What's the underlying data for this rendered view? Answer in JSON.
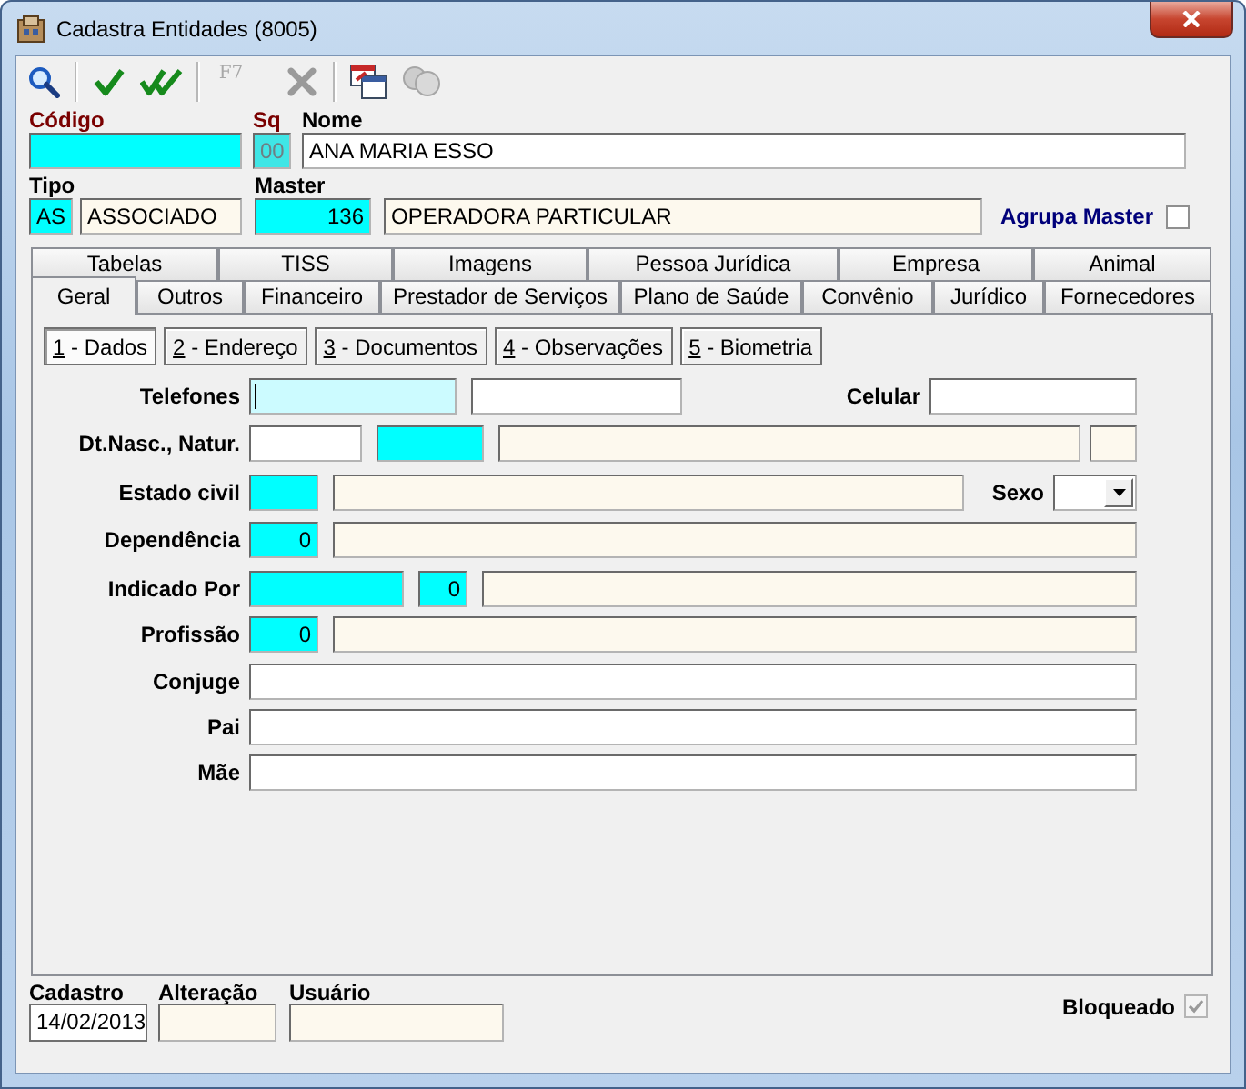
{
  "window": {
    "title": "Cadastra Entidades (8005)"
  },
  "toolbar": [
    [
      {
        "kind": "search",
        "disabled": false
      }
    ],
    [
      {
        "kind": "confirm",
        "disabled": false
      },
      {
        "kind": "confirm-all",
        "disabled": false
      }
    ],
    [
      {
        "kind": "f7",
        "label": "F7",
        "disabled": true
      },
      {
        "kind": "cancel",
        "disabled": true
      }
    ],
    [
      {
        "kind": "windows",
        "disabled": false
      },
      {
        "kind": "coins",
        "disabled": true
      }
    ]
  ],
  "header": [
    [
      {
        "label": "Código",
        "required_label": true,
        "fields": [
          {
            "kind": "required"
          }
        ]
      },
      {
        "label": "Sq",
        "required_label": true,
        "fields": [
          {
            "value": "00",
            "kind": "locked"
          }
        ]
      },
      {
        "label": "Nome",
        "required_label": false,
        "fields": [
          {
            "value": "ANA MARIA ESSO",
            "kind": "normal"
          }
        ]
      }
    ],
    [
      {
        "label": "Tipo",
        "required_label": false,
        "fields": [
          {
            "value": "AS",
            "kind": "required"
          },
          {
            "value": "ASSOCIADO",
            "kind": "readonly"
          }
        ]
      },
      {
        "label": "Master",
        "required_label": false,
        "fields": [
          {
            "value": "136",
            "kind": "required",
            "numeric": true
          },
          {
            "value": "OPERADORA PARTICULAR",
            "kind": "readonly"
          }
        ]
      }
    ]
  ],
  "agrupa_master": {
    "label": "Agrupa Master",
    "checked": false,
    "disabled": false
  },
  "tab_rows": [
    [
      {
        "label": "Tabelas",
        "selected": false
      },
      {
        "label": "TISS",
        "selected": false
      },
      {
        "label": "Imagens",
        "selected": false
      },
      {
        "label": "Pessoa Jurídica",
        "selected": false
      },
      {
        "label": "Empresa",
        "selected": false
      },
      {
        "label": "Animal",
        "selected": false
      }
    ],
    [
      {
        "label": "Geral",
        "selected": true
      },
      {
        "label": "Outros",
        "selected": false
      },
      {
        "label": "Financeiro",
        "selected": false
      },
      {
        "label": "Prestador de Serviços",
        "selected": false
      },
      {
        "label": "Plano de Saúde",
        "selected": false
      },
      {
        "label": "Convênio",
        "selected": false
      },
      {
        "label": "Jurídico",
        "selected": false
      },
      {
        "label": "Fornecedores",
        "selected": false
      }
    ]
  ],
  "subtabs": [
    {
      "label": "1 - Dados",
      "selected": true
    },
    {
      "label": "2 - Endereço",
      "selected": false
    },
    {
      "label": "3 - Documentos",
      "selected": false
    },
    {
      "label": "4 - Observações",
      "selected": false
    },
    {
      "label": "5 - Biometria",
      "selected": false
    }
  ],
  "form_rows": [
    {
      "label": "Telefones",
      "fields": [
        {
          "kind": "focused"
        },
        {
          "kind": "normal"
        }
      ],
      "extra": {
        "label": "Celular",
        "fields": [
          {
            "kind": "normal"
          }
        ]
      }
    },
    {
      "label": "Dt.Nasc., Natur.",
      "fields": [
        {
          "kind": "normal"
        },
        {
          "kind": "required"
        },
        {
          "kind": "readonly"
        },
        {
          "kind": "readonly"
        }
      ]
    },
    {
      "label": "Estado civil",
      "fields": [
        {
          "kind": "required"
        },
        {
          "kind": "readonly"
        }
      ],
      "extra": {
        "label": "Sexo",
        "fields": [
          {
            "kind": "combo"
          }
        ]
      }
    },
    {
      "label": "Dependência",
      "fields": [
        {
          "value": "0",
          "kind": "required",
          "numeric": true
        },
        {
          "kind": "readonly"
        }
      ]
    },
    {
      "label": "Indicado Por",
      "fields": [
        {
          "kind": "required"
        },
        {
          "value": "0",
          "kind": "required",
          "numeric": true
        },
        {
          "kind": "readonly"
        }
      ]
    },
    {
      "label": "Profissão",
      "fields": [
        {
          "value": "0",
          "kind": "required",
          "numeric": true
        },
        {
          "kind": "readonly"
        }
      ]
    },
    {
      "label": "Conjuge",
      "fields": [
        {
          "kind": "normal"
        }
      ]
    },
    {
      "label": "Pai",
      "fields": [
        {
          "kind": "normal"
        }
      ]
    },
    {
      "label": "Mãe",
      "fields": [
        {
          "kind": "normal"
        }
      ]
    }
  ],
  "footer": {
    "fields": [
      {
        "label": "Cadastro",
        "value": "14/02/2013",
        "kind": "plain"
      },
      {
        "label": "Alteração",
        "kind": "readonly"
      },
      {
        "label": "Usuário",
        "kind": "readonly"
      }
    ],
    "bloqueado": {
      "label": "Bloqueado",
      "checked": true,
      "disabled": true
    }
  }
}
